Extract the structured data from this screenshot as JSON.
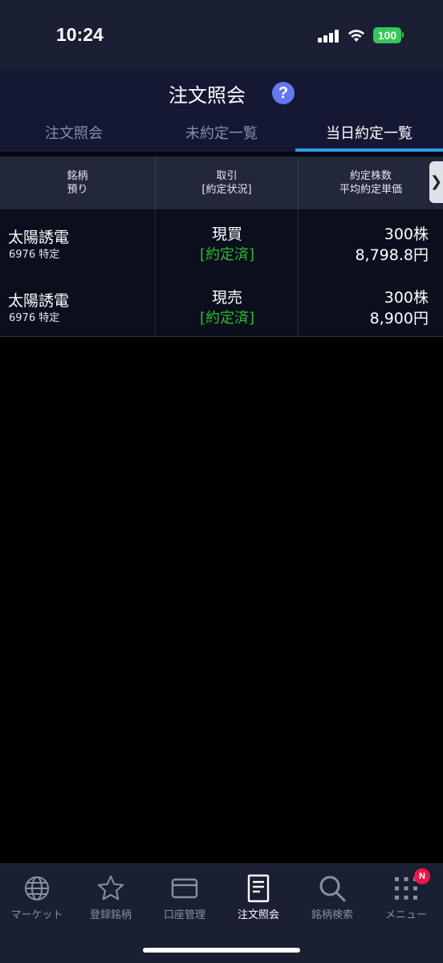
{
  "status": {
    "time": "10:24",
    "battery": "100"
  },
  "header": {
    "title": "注文照会",
    "help": "?"
  },
  "tabs": [
    {
      "label": "注文照会"
    },
    {
      "label": "未約定一覧"
    },
    {
      "label": "当日約定一覧"
    }
  ],
  "table": {
    "headers": [
      {
        "line1": "銘柄",
        "line2": "預り"
      },
      {
        "line1": "取引",
        "line2": "[約定状況]"
      },
      {
        "line1": "約定株数",
        "line2": "平均約定単価"
      }
    ],
    "scroll_glyph": "❯",
    "rows": [
      {
        "name": "太陽誘電",
        "sub": "6976 特定",
        "trade": "現買",
        "status": "[約定済]",
        "qty": "300株",
        "price": "8,798.8円"
      },
      {
        "name": "太陽誘電",
        "sub": "6976 特定",
        "trade": "現売",
        "status": "[約定済]",
        "qty": "300株",
        "price": "8,900円"
      }
    ]
  },
  "bottom_nav": [
    {
      "label": "マーケット",
      "icon": "globe-icon"
    },
    {
      "label": "登録銘柄",
      "icon": "star-icon"
    },
    {
      "label": "口座管理",
      "icon": "card-icon"
    },
    {
      "label": "注文照会",
      "icon": "document-icon",
      "active": true
    },
    {
      "label": "銘柄検索",
      "icon": "search-icon"
    },
    {
      "label": "メニュー",
      "icon": "grid-icon",
      "badge": "N"
    }
  ],
  "colors": {
    "accent": "#2f9fe4",
    "executed": "#2fbe2c",
    "badge": "#e6184d",
    "help": "#6677ee"
  }
}
